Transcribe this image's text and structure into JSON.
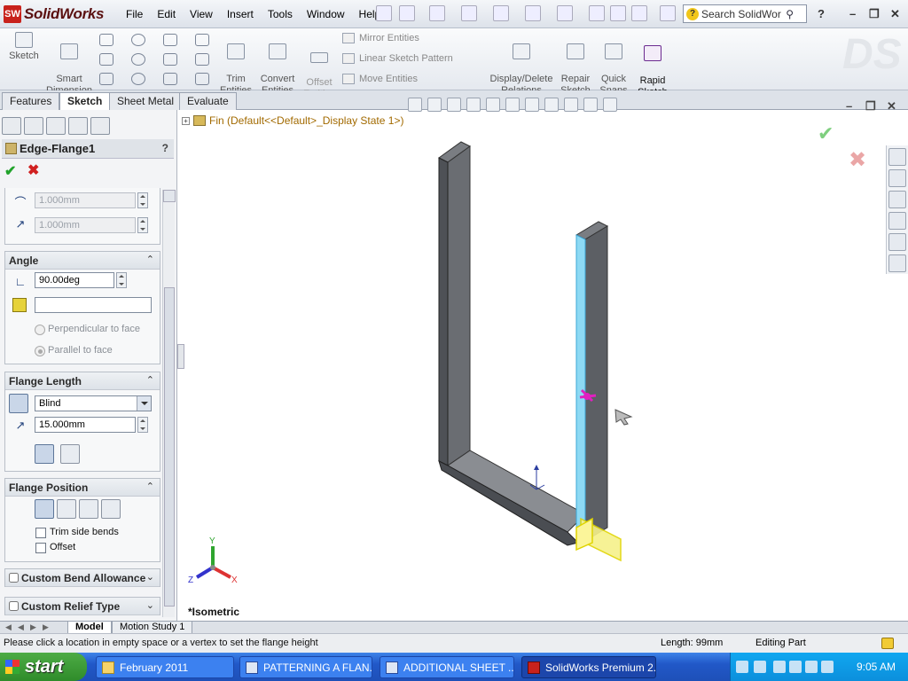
{
  "app": {
    "name": "SolidWorks",
    "logo_badge": "SW"
  },
  "menu": [
    "File",
    "Edit",
    "View",
    "Insert",
    "Tools",
    "Window",
    "Help"
  ],
  "search": {
    "placeholder": "Search SolidWor"
  },
  "commands": {
    "sketch": "Sketch",
    "smart_dimension": "Smart\nDimension",
    "trim_entities": "Trim\nEntities",
    "convert_entities": "Convert\nEntities",
    "offset_entities": "Offset\nEntities",
    "mirror_entities": "Mirror Entities",
    "linear_sketch_pattern": "Linear Sketch Pattern",
    "move_entities": "Move Entities",
    "display_delete_relations": "Display/Delete\nRelations",
    "repair_sketch": "Repair\nSketch",
    "quick_snaps": "Quick\nSnaps",
    "rapid_sketch": "Rapid\nSketch"
  },
  "tabs": [
    "Features",
    "Sketch",
    "Sheet Metal",
    "Evaluate"
  ],
  "active_tab": "Sketch",
  "property_manager": {
    "title": "Edge-Flange1",
    "help": "?",
    "bend_radius": "1.000mm",
    "gap": "1.000mm",
    "angle_group": {
      "title": "Angle",
      "angle_value": "90.00deg",
      "face_value": "",
      "option_perpendicular": "Perpendicular to face",
      "option_parallel": "Parallel to face",
      "selected_option": "Parallel to face"
    },
    "flange_length_group": {
      "title": "Flange Length",
      "end_condition": "Blind",
      "length_value": "15.000mm"
    },
    "flange_position_group": {
      "title": "Flange Position",
      "trim_side_bends": "Trim side bends",
      "trim_side_bends_checked": false,
      "offset": "Offset",
      "offset_checked": false
    },
    "custom_bend_allowance": {
      "title": "Custom Bend Allowance",
      "checked": false
    },
    "custom_relief_type": {
      "title": "Custom Relief Type",
      "checked": false
    }
  },
  "viewport": {
    "tree_label": "Fin  (Default<<Default>_Display State 1>)",
    "view_name": "*Isometric",
    "triad": {
      "x": "X",
      "y": "Y",
      "z": "Z"
    }
  },
  "bottom_tabs": [
    "Model",
    "Motion Study 1"
  ],
  "status": {
    "message": "Please click a location in empty space or a vertex to set the flange height",
    "length": "Length: 99mm",
    "mode": "Editing Part"
  },
  "taskbar": {
    "start": "start",
    "buttons": [
      "February 2011",
      "PATTERNING A FLAN...",
      "ADDITIONAL SHEET ...",
      "SolidWorks Premium 2..."
    ],
    "active_button": "SolidWorks Premium 2...",
    "clock": "9:05 AM"
  },
  "colors": {
    "part_face": "#5a5d62",
    "part_edge_highlight": "#7fd6f5",
    "preview_yellow": "#f2ee2a",
    "drag_handle": "#e020c0",
    "brand_red": "#c8221c"
  }
}
